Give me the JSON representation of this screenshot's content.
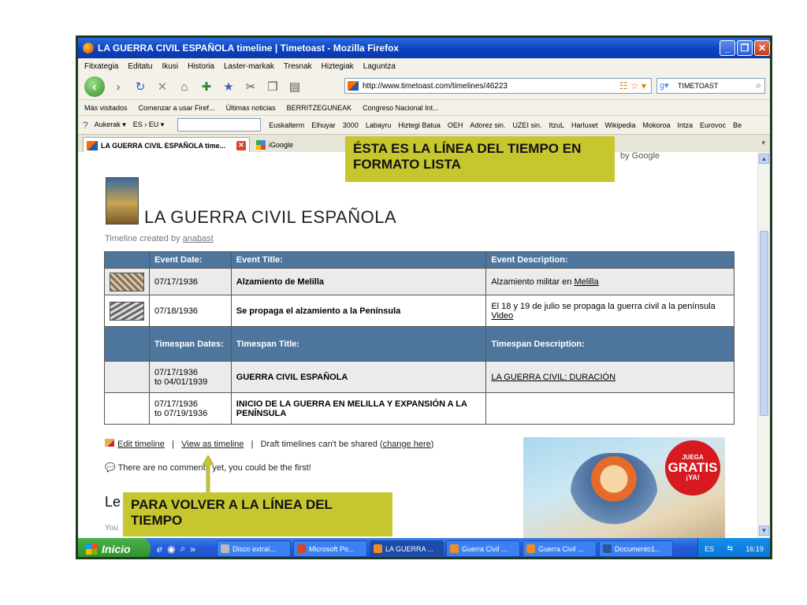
{
  "window": {
    "title": "LA GUERRA CIVIL ESPAÑOLA timeline | Timetoast - Mozilla Firefox"
  },
  "menu": [
    "Fitxategia",
    "Editatu",
    "Ikusi",
    "Historia",
    "Laster-markak",
    "Tresnak",
    "Hiztegiak",
    "Laguntza"
  ],
  "nav": {
    "url": "http://www.timetoast.com/timelines/46223",
    "search_value": "TIMETOAST"
  },
  "bookmarks": [
    "Más visitados",
    "Comenzar a usar Firef...",
    "Últimas noticias",
    "BERRITZEGUNEAK",
    "Congreso Nacional Int..."
  ],
  "addons": {
    "items": [
      "Aukerak ▾",
      "ES › EU ▾"
    ],
    "links": [
      "Euskalterm",
      "Elhuyar",
      "3000",
      "Labayru",
      "Hiztegi Batua",
      "OEH",
      "Adorez sin.",
      "UZEI sin.",
      "ItzuL",
      "Harluxet",
      "Wikipedia",
      "Mokoroa",
      "Intza",
      "Eurovoc",
      "Be"
    ]
  },
  "tabs": [
    {
      "label": "LA GUERRA CIVIL ESPAÑOLA time..."
    },
    {
      "label": "iGoogle"
    }
  ],
  "page": {
    "title": "LA GUERRA CIVIL ESPAÑOLA",
    "created_prefix": "Timeline created by ",
    "created_user": "anabast",
    "google_label": "by Google",
    "event_headers": [
      "Event Date:",
      "Event Title:",
      "Event Description:"
    ],
    "events": [
      {
        "date": "07/17/1936",
        "title": "Alzamiento de Melilla",
        "desc_text": "Alzamiento militar en ",
        "desc_link": "Melilla"
      },
      {
        "date": "07/18/1936",
        "title": "Se propaga el alzamiento a la Península",
        "desc_text": "El 18 y 19 de julio se propaga la guerra civil a la península ",
        "desc_link": "Video"
      }
    ],
    "timespan_headers": [
      "Timespan Dates:",
      "Timespan Title:",
      "Timespan Description:"
    ],
    "timespans": [
      {
        "from": "07/17/1936",
        "to": "to 04/01/1939",
        "title": "GUERRA CIVIL ESPAÑOLA",
        "desc": "LA GUERRA CIVIL: DURACIÓN"
      },
      {
        "from": "07/17/1936",
        "to": "to 07/19/1936",
        "title": "INICIO DE LA GUERRA EN MELILLA Y EXPANSIÓN A LA PENÍNSULA",
        "desc": ""
      }
    ],
    "edit_link": "Edit timeline",
    "view_link": "View as timeline",
    "draft_text": "Draft timelines can't be shared (",
    "change_link": "change here",
    "draft_end": ")",
    "no_comments": "There are no comments yet, you could be the first!",
    "section_heading": "Le",
    "you_text": "You",
    "ad": {
      "line1": "JUEGA",
      "line2": "GRATIS",
      "line3": "¡YA!"
    }
  },
  "annotations": {
    "top": "ÉSTA ES LA LÍNEA DEL TIEMPO EN FORMATO LISTA",
    "bottom": "PARA VOLVER A LA LÍNEA DEL TIEMPO",
    "color": "#c6c72f"
  },
  "taskbar": {
    "start": "Inicio",
    "tasks": [
      "Disco extraí...",
      "Microsoft Po...",
      "LA GUERRA ...",
      "Guerra Civil ...",
      "Guerra Civil ...",
      "Documento1..."
    ],
    "lang": "ES",
    "clock": "16:19"
  }
}
